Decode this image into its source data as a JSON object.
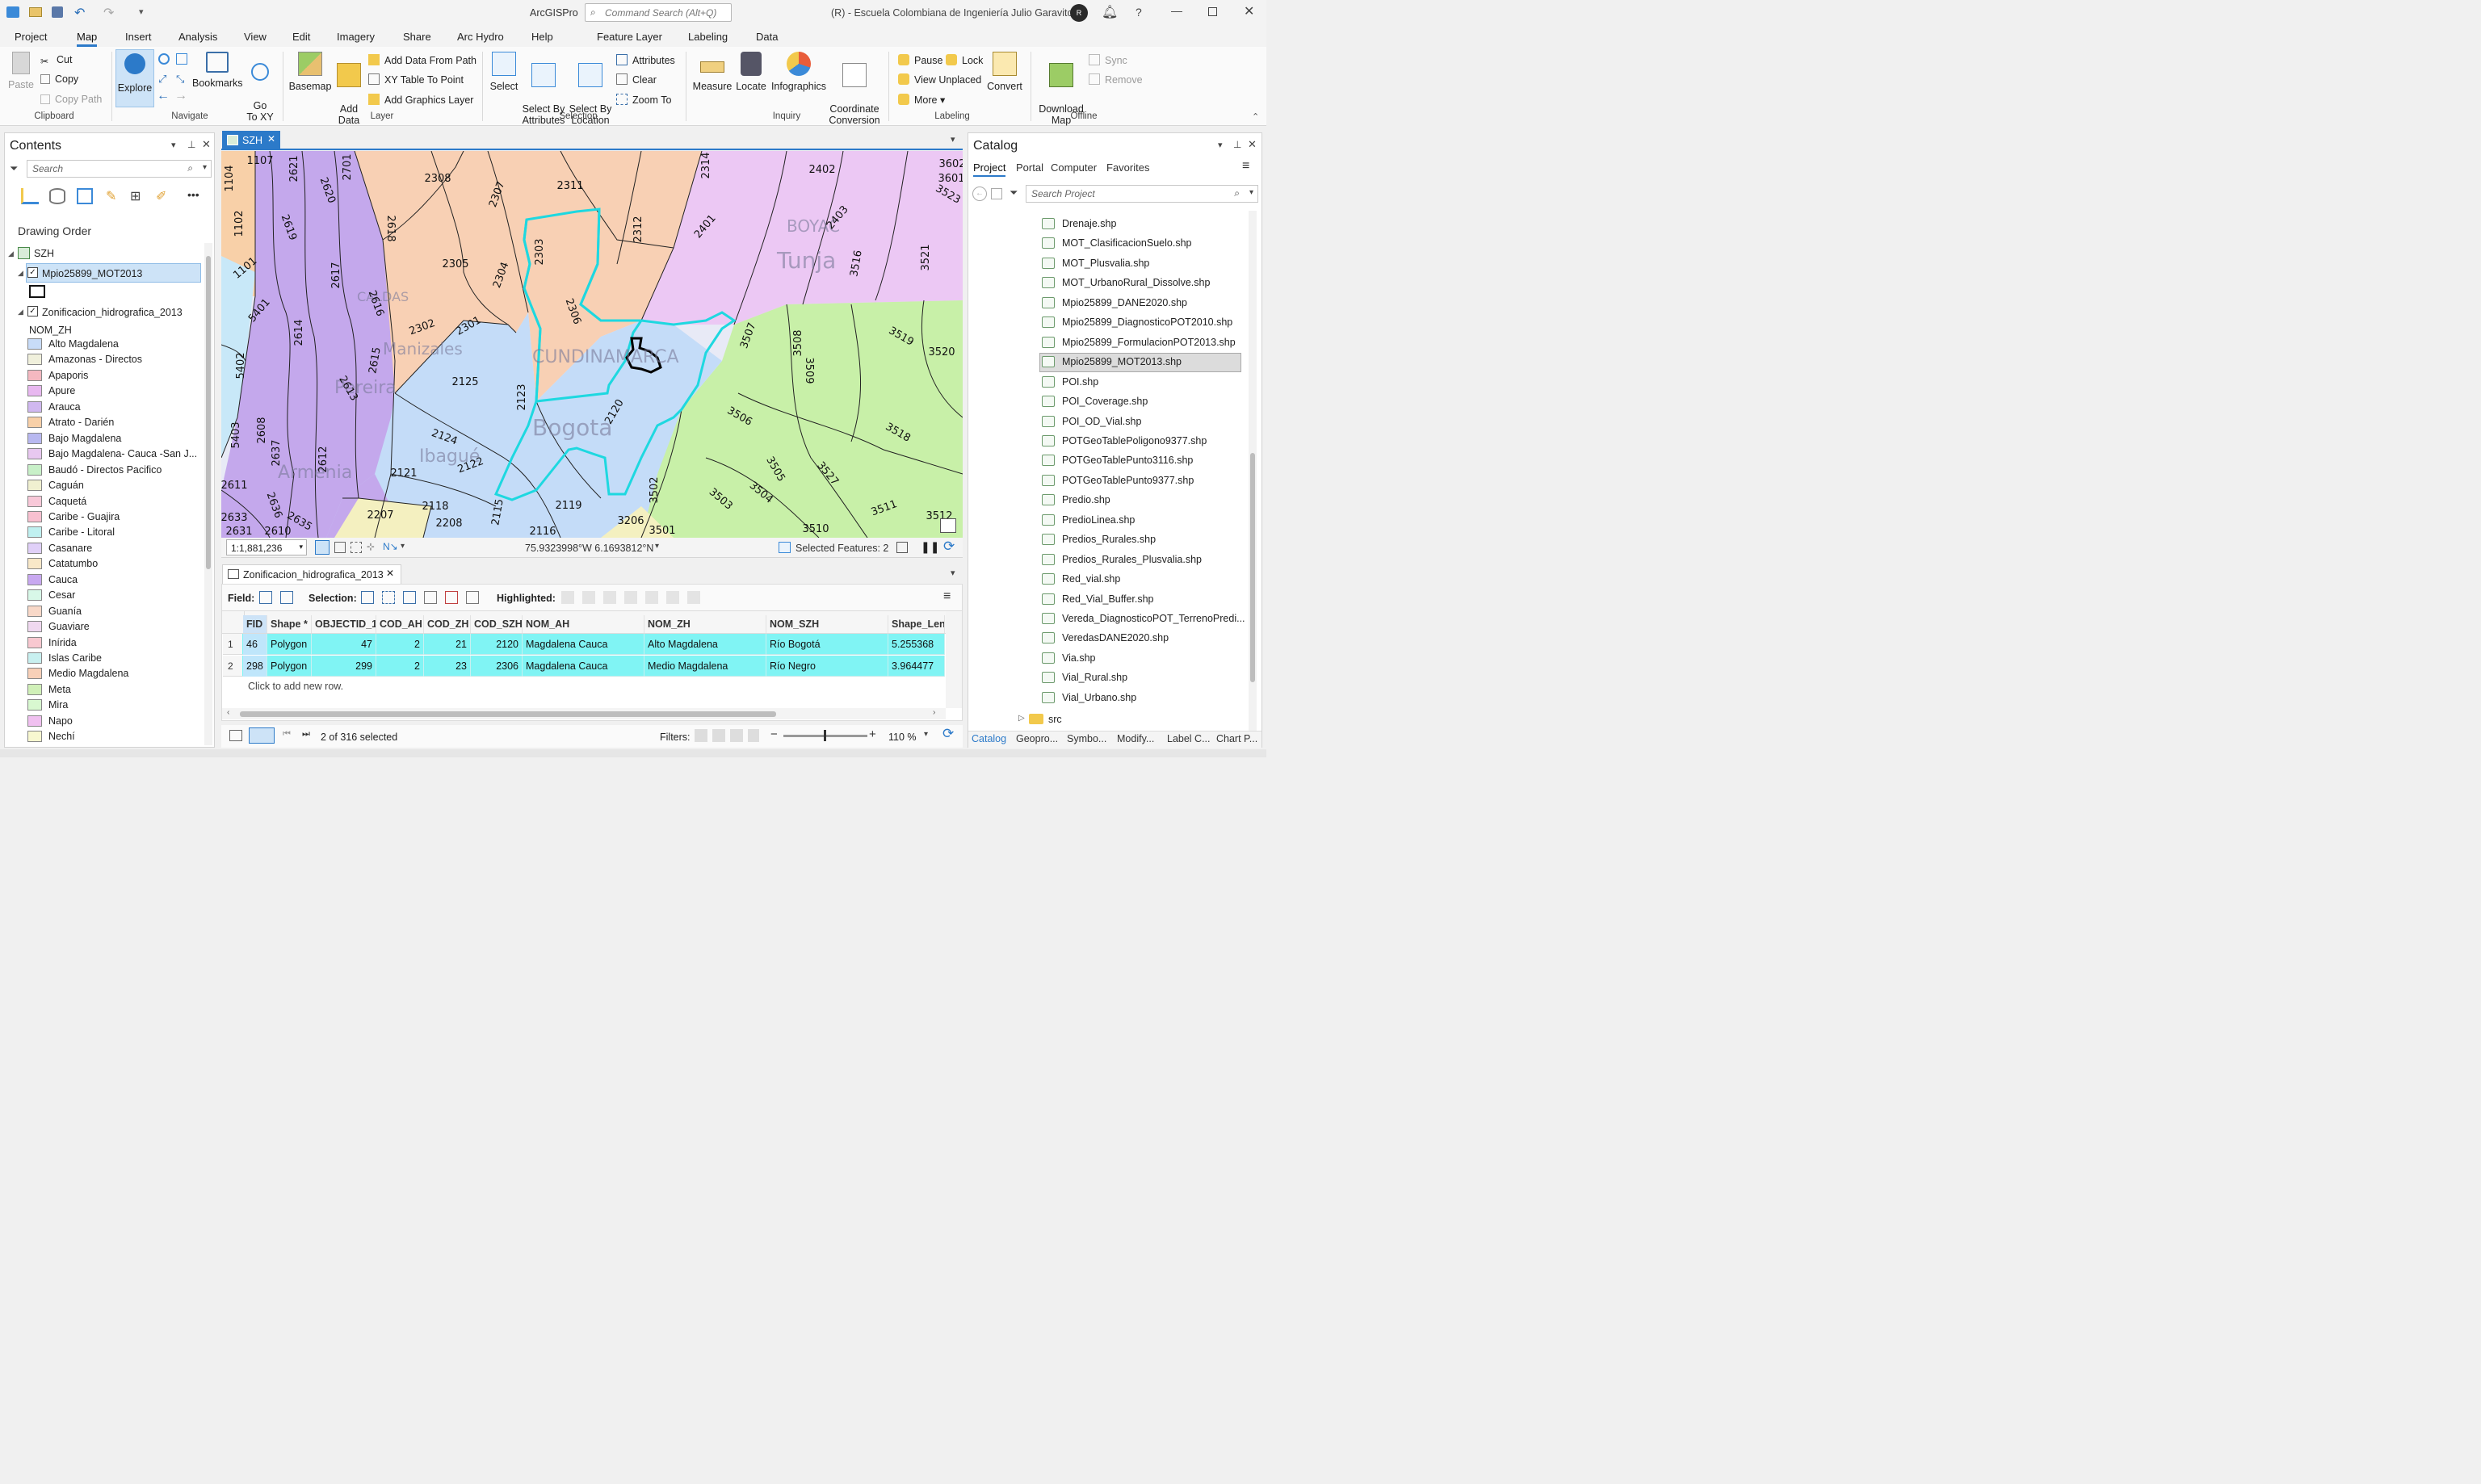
{
  "app": {
    "title": "ArcGISPro",
    "command_search_placeholder": "Command Search (Alt+Q)",
    "org": "(R)  -  Escuela Colombiana de Ingeniería Julio Garavito",
    "avatar": "R"
  },
  "ribbon_tabs": [
    "Project",
    "Map",
    "Insert",
    "Analysis",
    "View",
    "Edit",
    "Imagery",
    "Share",
    "Arc Hydro",
    "Help"
  ],
  "context_tabs": [
    "Feature Layer",
    "Labeling",
    "Data"
  ],
  "clipboard": {
    "paste": "Paste",
    "cut": "Cut",
    "copy": "Copy",
    "copy_path": "Copy Path",
    "label": "Clipboard"
  },
  "navigate": {
    "explore": "Explore",
    "bookmarks": "Bookmarks",
    "go_to_xy": "Go\nTo XY",
    "label": "Navigate"
  },
  "layer": {
    "basemap": "Basemap",
    "add_data": "Add\nData",
    "add_data_from_path": "Add Data From Path",
    "xy_table_to_point": "XY Table To Point",
    "add_graphics_layer": "Add Graphics Layer",
    "label": "Layer"
  },
  "selection": {
    "select": "Select",
    "select_by_attributes": "Select By\nAttributes",
    "select_by_location": "Select By\nLocation",
    "attributes": "Attributes",
    "clear": "Clear",
    "zoom_to": "Zoom To",
    "label": "Selection"
  },
  "inquiry": {
    "measure": "Measure",
    "locate": "Locate",
    "infographics": "Infographics",
    "coordinate_conversion": "Coordinate\nConversion",
    "label": "Inquiry"
  },
  "labeling": {
    "pause": "Pause",
    "lock": "Lock",
    "view_unplaced": "View Unplaced",
    "more": "More",
    "convert": "Convert",
    "label": "Labeling"
  },
  "offline": {
    "download_map": "Download\nMap",
    "sync": "Sync",
    "remove": "Remove",
    "label": "Offline"
  },
  "contents": {
    "title": "Contents",
    "search_placeholder": "Search",
    "drawing_order": "Drawing Order",
    "map_name": "SZH",
    "layer1": "Mpio25899_MOT2013",
    "layer2": "Zonificacion_hidrografica_2013",
    "field": "NOM_ZH",
    "legend": [
      {
        "label": "Alto Magdalena",
        "color": "#c8dcf8"
      },
      {
        "label": "Amazonas  -  Directos",
        "color": "#f0f0dc"
      },
      {
        "label": "Apaporis",
        "color": "#f4b8c0"
      },
      {
        "label": "Apure",
        "color": "#e8b8f0"
      },
      {
        "label": "Arauca",
        "color": "#d0b8f0"
      },
      {
        "label": "Atrato  -  Darién",
        "color": "#f8d0a8"
      },
      {
        "label": "Bajo Magdalena",
        "color": "#b8b8f0"
      },
      {
        "label": "Bajo Magdalena- Cauca -San J...",
        "color": "#e8c8f0"
      },
      {
        "label": "Baudó  -  Directos Pacifico",
        "color": "#c8f0c8"
      },
      {
        "label": "Caguán",
        "color": "#f0f0d0"
      },
      {
        "label": "Caquetá",
        "color": "#f8c8d8"
      },
      {
        "label": "Caribe  -  Guajira",
        "color": "#f8c0d0"
      },
      {
        "label": "Caribe  -  Litoral",
        "color": "#c0f0f0"
      },
      {
        "label": "Casanare",
        "color": "#e0d0f8"
      },
      {
        "label": "Catatumbo",
        "color": "#f8e8c8"
      },
      {
        "label": "Cauca",
        "color": "#c8a8f0"
      },
      {
        "label": "Cesar",
        "color": "#d8f8e8"
      },
      {
        "label": "Guanía",
        "color": "#f8d8c8"
      },
      {
        "label": "Guaviare",
        "color": "#f0d8f0"
      },
      {
        "label": "Inírida",
        "color": "#f8c8d0"
      },
      {
        "label": "Islas Caribe",
        "color": "#c8f0f0"
      },
      {
        "label": "Medio Magdalena",
        "color": "#f8d0b8"
      },
      {
        "label": "Meta",
        "color": "#d0f0b8"
      },
      {
        "label": "Mira",
        "color": "#d8f8d0"
      },
      {
        "label": "Napo",
        "color": "#f0c0f0"
      },
      {
        "label": "Nechí",
        "color": "#f8f8d0"
      }
    ]
  },
  "map_view": {
    "tab": "SZH",
    "scale": "1:1,881,236",
    "coords": "75.9323998°W 6.1693812°N",
    "selected_features": "Selected Features: 2",
    "zones": [
      "1104",
      "1107",
      "2621",
      "2701",
      "2308",
      "2311",
      "2314",
      "2402",
      "3602",
      "3601",
      "3523",
      "2620",
      "1102",
      "2619",
      "2618",
      "2307",
      "2303",
      "2312",
      "2401",
      "2403",
      "1101",
      "2617",
      "2305",
      "2304",
      "2306",
      "3516",
      "3521",
      "5401",
      "2616",
      "2302",
      "2301",
      "2614",
      "2615",
      "3507",
      "3508",
      "3519",
      "3520",
      "5402",
      "2125",
      "2123",
      "2120",
      "3509",
      "2613",
      "3506",
      "3518",
      "5403",
      "2608",
      "2637",
      "2612",
      "2124",
      "2122",
      "3502",
      "3505",
      "3527",
      "2611",
      "2121",
      "2118",
      "2119",
      "3503",
      "3504",
      "3511",
      "3512",
      "2633",
      "2636",
      "2635",
      "2207",
      "2208",
      "2116",
      "3206",
      "3501",
      "3510",
      "2631",
      "2610",
      "2115"
    ],
    "place_labels": [
      "BOYAC",
      "Tunja",
      "CUNDINAMARCA",
      "Bogota",
      "Manizales",
      "Pereira",
      "Armenia",
      "Ibagué",
      "CALDAS"
    ]
  },
  "table": {
    "tab": "Zonificacion_hidrografica_2013",
    "field_label": "Field:",
    "selection_label": "Selection:",
    "highlighted_label": "Highlighted:",
    "columns": [
      "FID",
      "Shape *",
      "OBJECTID_1",
      "COD_AH",
      "COD_ZH",
      "COD_SZH",
      "NOM_AH",
      "NOM_ZH",
      "NOM_SZH",
      "Shape_Leng"
    ],
    "rows": [
      {
        "n": "1",
        "FID": "46",
        "Shape": "Polygon",
        "OBJECTID_1": "47",
        "COD_AH": "2",
        "COD_ZH": "21",
        "COD_SZH": "2120",
        "NOM_AH": "Magdalena Cauca",
        "NOM_ZH": "Alto Magdalena",
        "NOM_SZH": "Río Bogotá",
        "Shape_Leng": "5.255368"
      },
      {
        "n": "2",
        "FID": "298",
        "Shape": "Polygon",
        "OBJECTID_1": "299",
        "COD_AH": "2",
        "COD_ZH": "23",
        "COD_SZH": "2306",
        "NOM_AH": "Magdalena Cauca",
        "NOM_ZH": "Medio Magdalena",
        "NOM_SZH": "Río Negro",
        "Shape_Leng": "3.964477"
      }
    ],
    "add_row": "Click to add new row.",
    "status": "2 of 316 selected",
    "filters": "Filters:",
    "zoom": "110 %"
  },
  "catalog": {
    "title": "Catalog",
    "tabs": [
      "Project",
      "Portal",
      "Computer",
      "Favorites"
    ],
    "search_placeholder": "Search Project",
    "items": [
      "Drenaje.shp",
      "MOT_ClasificacionSuelo.shp",
      "MOT_Plusvalia.shp",
      "MOT_UrbanoRural_Dissolve.shp",
      "Mpio25899_DANE2020.shp",
      "Mpio25899_DiagnosticoPOT2010.shp",
      "Mpio25899_FormulacionPOT2013.shp",
      "Mpio25899_MOT2013.shp",
      "POI.shp",
      "POI_Coverage.shp",
      "POI_OD_Vial.shp",
      "POTGeoTablePoligono9377.shp",
      "POTGeoTablePunto3116.shp",
      "POTGeoTablePunto9377.shp",
      "Predio.shp",
      "PredioLinea.shp",
      "Predios_Rurales.shp",
      "Predios_Rurales_Plusvalia.shp",
      "Red_vial.shp",
      "Red_Vial_Buffer.shp",
      "Vereda_DiagnosticoPOT_TerrenoPredi...",
      "VeredasDANE2020.shp",
      "Via.shp",
      "Vial_Rural.shp",
      "Vial_Urbano.shp"
    ],
    "folder": "src",
    "bottom_tabs": [
      "Catalog",
      "Geopro...",
      "Symbo...",
      "Modify...",
      "Label C...",
      "Chart P..."
    ]
  }
}
